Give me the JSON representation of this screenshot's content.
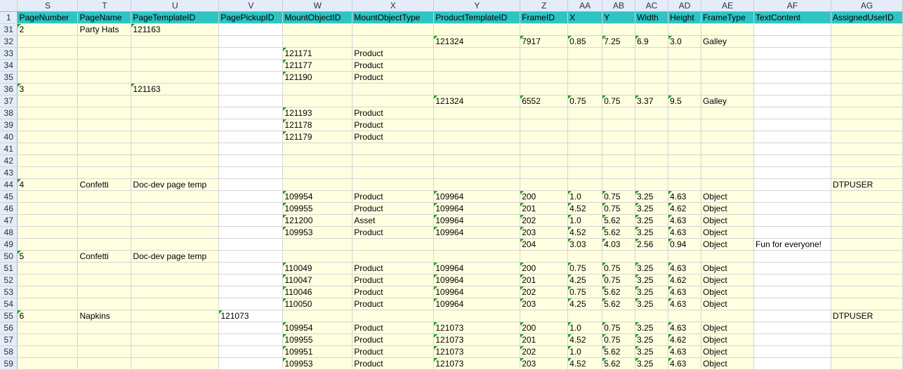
{
  "sheet": {
    "column_letters": [
      "S",
      "T",
      "U",
      "V",
      "W",
      "X",
      "Y",
      "Z",
      "AA",
      "AB",
      "AC",
      "AD",
      "AE",
      "AF",
      "AG"
    ],
    "header_row_number": "1",
    "headers": [
      "PageNumber",
      "PageName",
      "PageTemplateID",
      "PagePickupID",
      "MountObjectID",
      "MountObjectType",
      "ProductTemplateID",
      "FrameID",
      "X",
      "Y",
      "Width",
      "Height",
      "FrameType",
      "TextContent",
      "AssignedUserID"
    ],
    "rows": [
      {
        "n": "31",
        "cells": [
          "2",
          "Party Hats",
          "121163",
          "",
          "",
          "",
          "",
          "",
          "",
          "",
          "",
          "",
          "",
          "",
          ""
        ]
      },
      {
        "n": "32",
        "cells": [
          "",
          "",
          "",
          "",
          "",
          "",
          "121324",
          "7917",
          "0.85",
          "7.25",
          "6.9",
          "3.0",
          "Galley",
          "",
          ""
        ]
      },
      {
        "n": "33",
        "cells": [
          "",
          "",
          "",
          "",
          "121171",
          "Product",
          "",
          "",
          "",
          "",
          "",
          "",
          "",
          "",
          ""
        ]
      },
      {
        "n": "34",
        "cells": [
          "",
          "",
          "",
          "",
          "121177",
          "Product",
          "",
          "",
          "",
          "",
          "",
          "",
          "",
          "",
          ""
        ]
      },
      {
        "n": "35",
        "cells": [
          "",
          "",
          "",
          "",
          "121190",
          "Product",
          "",
          "",
          "",
          "",
          "",
          "",
          "",
          "",
          ""
        ]
      },
      {
        "n": "36",
        "cells": [
          "3",
          "",
          "121163",
          "",
          "",
          "",
          "",
          "",
          "",
          "",
          "",
          "",
          "",
          "",
          ""
        ]
      },
      {
        "n": "37",
        "cells": [
          "",
          "",
          "",
          "",
          "",
          "",
          "121324",
          "6552",
          "0.75",
          "0.75",
          "3.37",
          "9.5",
          "Galley",
          "",
          ""
        ]
      },
      {
        "n": "38",
        "cells": [
          "",
          "",
          "",
          "",
          "121193",
          "Product",
          "",
          "",
          "",
          "",
          "",
          "",
          "",
          "",
          ""
        ]
      },
      {
        "n": "39",
        "cells": [
          "",
          "",
          "",
          "",
          "121178",
          "Product",
          "",
          "",
          "",
          "",
          "",
          "",
          "",
          "",
          ""
        ]
      },
      {
        "n": "40",
        "cells": [
          "",
          "",
          "",
          "",
          "121179",
          "Product",
          "",
          "",
          "",
          "",
          "",
          "",
          "",
          "",
          ""
        ]
      },
      {
        "n": "41",
        "cells": [
          "",
          "",
          "",
          "",
          "",
          "",
          "",
          "",
          "",
          "",
          "",
          "",
          "",
          "",
          ""
        ]
      },
      {
        "n": "42",
        "cells": [
          "",
          "",
          "",
          "",
          "",
          "",
          "",
          "",
          "",
          "",
          "",
          "",
          "",
          "",
          ""
        ]
      },
      {
        "n": "43",
        "cells": [
          "",
          "",
          "",
          "",
          "",
          "",
          "",
          "",
          "",
          "",
          "",
          "",
          "",
          "",
          ""
        ]
      },
      {
        "n": "44",
        "cells": [
          "4",
          "Confetti",
          "Doc-dev page temp",
          "",
          "",
          "",
          "",
          "",
          "",
          "",
          "",
          "",
          "",
          "",
          "DTPUSER"
        ]
      },
      {
        "n": "45",
        "cells": [
          "",
          "",
          "",
          "",
          "109954",
          "Product",
          "109964",
          "200",
          "1.0",
          "0.75",
          "3.25",
          "4.63",
          "Object",
          "",
          ""
        ]
      },
      {
        "n": "46",
        "cells": [
          "",
          "",
          "",
          "",
          "109955",
          "Product",
          "109964",
          "201",
          "4.52",
          "0.75",
          "3.25",
          "4.62",
          "Object",
          "",
          ""
        ]
      },
      {
        "n": "47",
        "cells": [
          "",
          "",
          "",
          "",
          "121200",
          "Asset",
          "109964",
          "202",
          "1.0",
          "5.62",
          "3.25",
          "4.63",
          "Object",
          "",
          ""
        ]
      },
      {
        "n": "48",
        "cells": [
          "",
          "",
          "",
          "",
          "109953",
          "Product",
          "109964",
          "203",
          "4.52",
          "5.62",
          "3.25",
          "4.63",
          "Object",
          "",
          ""
        ]
      },
      {
        "n": "49",
        "cells": [
          "",
          "",
          "",
          "",
          "",
          "",
          "",
          "204",
          "3.03",
          "4.03",
          "2.56",
          "0.94",
          "Object",
          "Fun for everyone!",
          ""
        ]
      },
      {
        "n": "50",
        "cells": [
          "5",
          "Confetti",
          "Doc-dev page temp",
          "",
          "",
          "",
          "",
          "",
          "",
          "",
          "",
          "",
          "",
          "",
          ""
        ]
      },
      {
        "n": "51",
        "cells": [
          "",
          "",
          "",
          "",
          "110049",
          "Product",
          "109964",
          "200",
          "0.75",
          "0.75",
          "3.25",
          "4.63",
          "Object",
          "",
          ""
        ]
      },
      {
        "n": "52",
        "cells": [
          "",
          "",
          "",
          "",
          "110047",
          "Product",
          "109964",
          "201",
          "4.25",
          "0.75",
          "3.25",
          "4.62",
          "Object",
          "",
          ""
        ]
      },
      {
        "n": "53",
        "cells": [
          "",
          "",
          "",
          "",
          "110046",
          "Product",
          "109964",
          "202",
          "0.75",
          "5.62",
          "3.25",
          "4.63",
          "Object",
          "",
          ""
        ]
      },
      {
        "n": "54",
        "cells": [
          "",
          "",
          "",
          "",
          "110050",
          "Product",
          "109964",
          "203",
          "4.25",
          "5.62",
          "3.25",
          "4.63",
          "Object",
          "",
          ""
        ]
      },
      {
        "n": "55",
        "cells": [
          "6",
          "Napkins",
          "",
          "121073",
          "",
          "",
          "",
          "",
          "",
          "",
          "",
          "",
          "",
          "",
          "DTPUSER"
        ]
      },
      {
        "n": "56",
        "cells": [
          "",
          "",
          "",
          "",
          "109954",
          "Product",
          "121073",
          "200",
          "1.0",
          "0.75",
          "3.25",
          "4.63",
          "Object",
          "",
          ""
        ]
      },
      {
        "n": "57",
        "cells": [
          "",
          "",
          "",
          "",
          "109955",
          "Product",
          "121073",
          "201",
          "4.52",
          "0.75",
          "3.25",
          "4.62",
          "Object",
          "",
          ""
        ]
      },
      {
        "n": "58",
        "cells": [
          "",
          "",
          "",
          "",
          "109951",
          "Product",
          "121073",
          "202",
          "1.0",
          "5.62",
          "3.25",
          "4.63",
          "Object",
          "",
          ""
        ]
      },
      {
        "n": "59",
        "cells": [
          "",
          "",
          "",
          "",
          "109953",
          "Product",
          "121073",
          "203",
          "4.52",
          "5.62",
          "3.25",
          "4.63",
          "Object",
          "",
          ""
        ]
      }
    ]
  }
}
